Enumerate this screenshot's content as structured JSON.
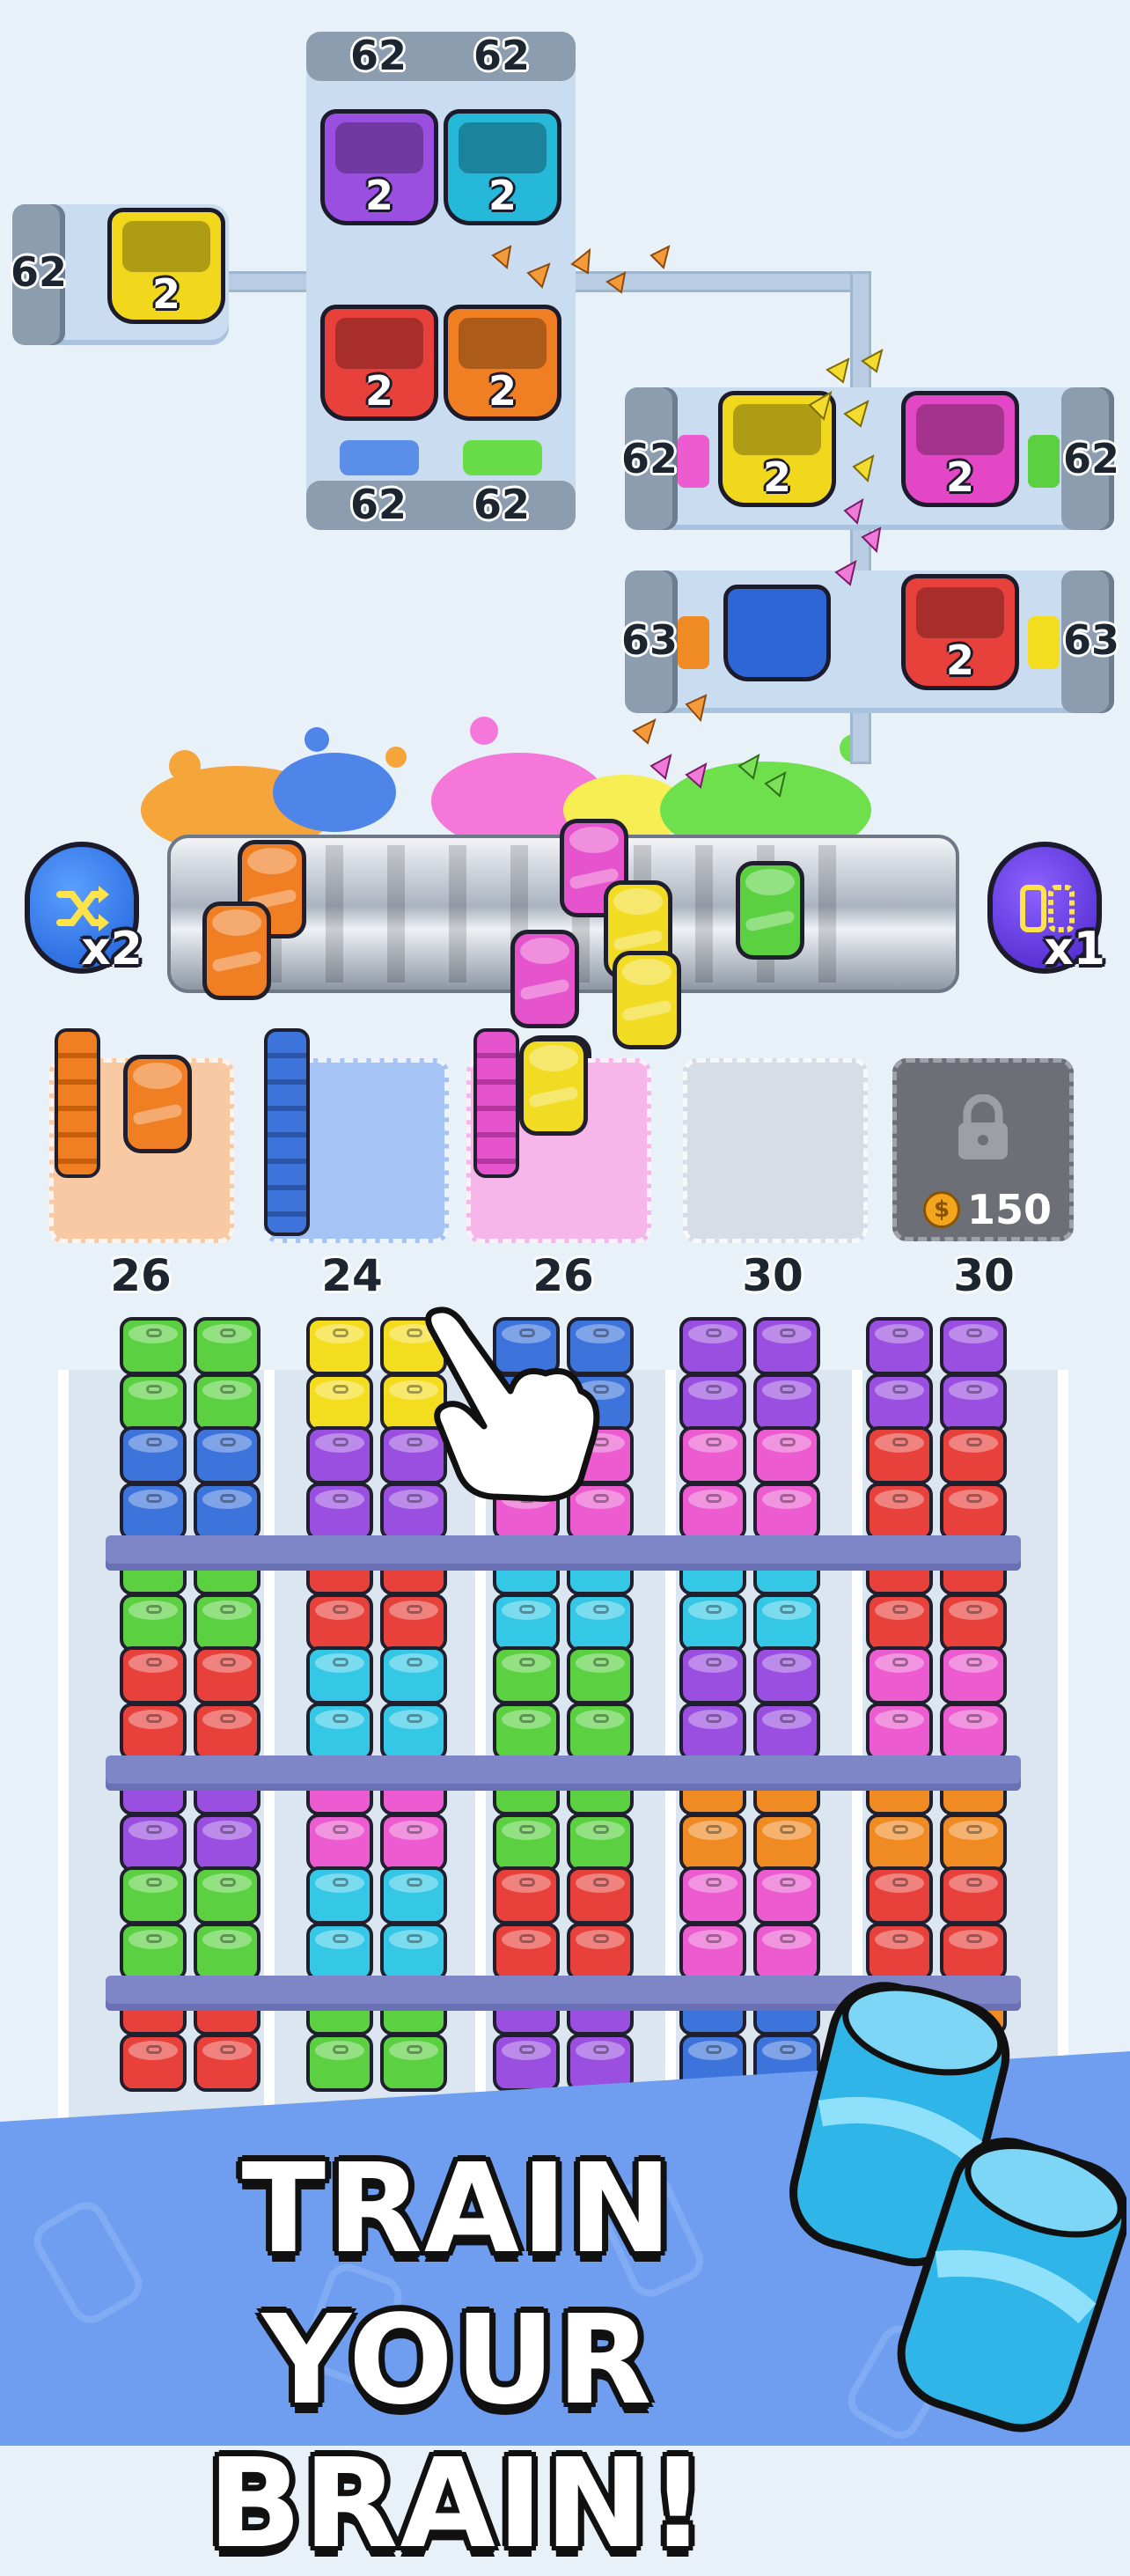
{
  "top_machines": {
    "left": {
      "counter": "62",
      "bins": [
        "2"
      ]
    },
    "center_top_counters": [
      "62",
      "62"
    ],
    "center_top_bins": [
      "2",
      "2"
    ],
    "center_bottom_bins": [
      "2",
      "2"
    ],
    "center_bottom_counters": [
      "62",
      "62"
    ],
    "right_top": {
      "left_counter": "62",
      "right_counter": "62",
      "bins": [
        "2",
        "2"
      ]
    },
    "right_bottom": {
      "left_counter": "63",
      "right_counter": "63",
      "bin": "2"
    }
  },
  "boosters": {
    "shuffle": {
      "icon": "shuffle-icon",
      "multiplier": "x2"
    },
    "swap": {
      "icon": "swap-icon",
      "multiplier": "x1"
    }
  },
  "locked_slot": {
    "price": "150",
    "icon": "lock-icon",
    "coin_icon": "coin-icon"
  },
  "column_counts": [
    "26",
    "24",
    "26",
    "30",
    "30"
  ],
  "colors": {
    "red": "#e8413b",
    "orange": "#f08a22",
    "yellow": "#f4dd1f",
    "green": "#5bd142",
    "blue": "#3d74dc",
    "cyan": "#35c8e6",
    "purple": "#9a4fe0",
    "pink": "#ec5cd0",
    "background": "#e9f1f8",
    "banner": "#6f9ef0"
  },
  "banner": {
    "line1": "TRAIN",
    "line2": "YOUR BRAIN!"
  }
}
